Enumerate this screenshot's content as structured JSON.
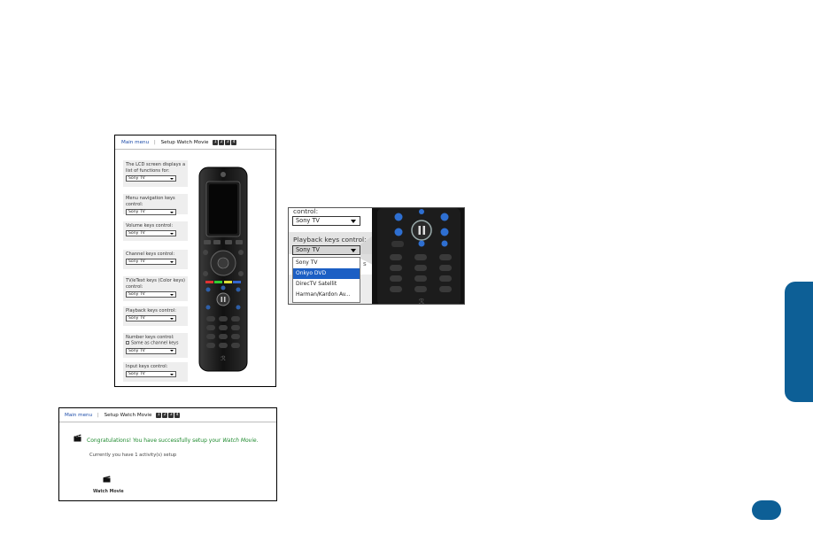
{
  "setup_page": {
    "breadcrumb": {
      "main_menu": "Main menu",
      "separator": "|",
      "current": "Setup Watch Movie",
      "steps": [
        "1",
        "2",
        "3",
        "4"
      ]
    },
    "fields": [
      {
        "label": "The LCD screen displays a list of functions for:",
        "value": "Sony TV"
      },
      {
        "label": "Menu navigation keys control:",
        "value": "Sony TV"
      },
      {
        "label": "Volume keys control:",
        "value": "Sony TV"
      },
      {
        "label": "Channel keys control:",
        "value": "Sony TV"
      },
      {
        "label": "TV/eText keys (Color keys) control:",
        "value": "Sony TV"
      },
      {
        "label": "Playback keys control:",
        "value": "Sony TV"
      },
      {
        "label": "Number keys control:",
        "checkbox": "Same as channel keys",
        "value": "Sony TV"
      },
      {
        "label": "Input keys control:",
        "value": "Sony TV"
      }
    ]
  },
  "success_page": {
    "breadcrumb": {
      "main_menu": "Main menu",
      "separator": "|",
      "current": "Setup Watch Movie",
      "steps": [
        "1",
        "2",
        "3",
        "4"
      ]
    },
    "congrats_prefix": "Congratulations! You have successfully setup your ",
    "congrats_activity": "Watch Movie",
    "congrats_suffix": ".",
    "status": "Currently you have 1 activity(s) setup",
    "activity_label": "Watch Movie"
  },
  "zoom_detail": {
    "top_label": "control:",
    "top_value": "Sony TV",
    "playback_label": "Playback keys control:",
    "playback_value": "Sony TV",
    "options": [
      "Sony TV",
      "Onkyo DVD",
      "DirecTV Satellit",
      "Harman/Kardon Av..."
    ],
    "selected_index": 1,
    "ghost_text": "s"
  },
  "colors": {
    "link": "#1a4aa8",
    "success": "#1e8a2e",
    "selection": "#1c5fc4",
    "side_tab": "#0d5f96"
  }
}
